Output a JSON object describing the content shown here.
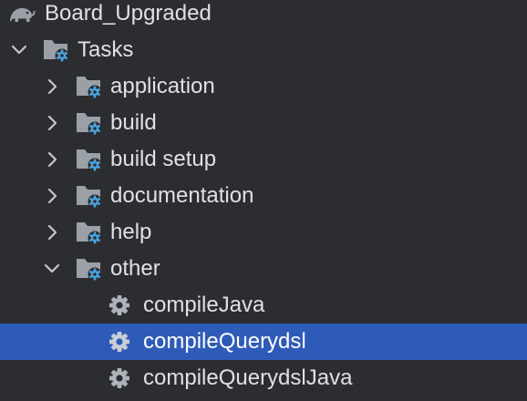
{
  "tree": {
    "root": {
      "label": "Board_Upgraded",
      "icon": "gradle-elephant-icon"
    },
    "tasks": {
      "label": "Tasks",
      "expanded": true,
      "icon": "folder-gear-icon"
    },
    "groups": [
      {
        "label": "application",
        "expanded": false
      },
      {
        "label": "build",
        "expanded": false
      },
      {
        "label": "build setup",
        "expanded": false
      },
      {
        "label": "documentation",
        "expanded": false
      },
      {
        "label": "help",
        "expanded": false
      },
      {
        "label": "other",
        "expanded": true
      }
    ],
    "other_tasks": [
      {
        "label": "compileJava",
        "selected": false
      },
      {
        "label": "compileQuerydsl",
        "selected": true
      },
      {
        "label": "compileQuerydslJava",
        "selected": false
      }
    ]
  },
  "colors": {
    "background": "#2b2d30",
    "selection": "#2f5bb8",
    "text": "#dfe1e5",
    "folder": "#9aa0a6",
    "gear_badge": "#4aa3df",
    "gear": "#aeb3b9"
  }
}
